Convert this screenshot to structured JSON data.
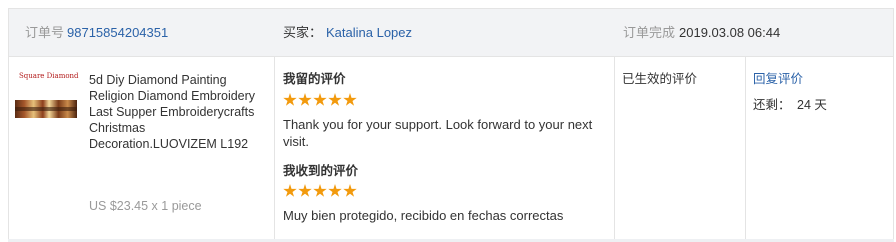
{
  "header": {
    "order_no_label": "订单号",
    "order_no_value": "98715854204351",
    "buyer_label": "买家：",
    "buyer_name": "Katalina Lopez",
    "completed_label": "订单完成",
    "completed_time": "2019.03.08 06:44"
  },
  "product": {
    "thumb_brand": "Square Diamond",
    "title": "5d Diy Diamond Painting Religion Diamond Embroidery Last Supper Embroiderycrafts Christmas Decoration.LUOVIZEM L192",
    "price": "US $23.45 x 1 piece"
  },
  "feedback": {
    "my_label": "我留的评价",
    "my_rating": 5,
    "my_text": "Thank you for your support. Look forward to your next visit.",
    "received_label": "我收到的评价",
    "received_rating": 5,
    "received_text": "Muy bien protegido, recibido en fechas correctas"
  },
  "status": {
    "label": "已生效的评价"
  },
  "action": {
    "reply_label": "回复评价",
    "remaining_label": "还剩：",
    "remaining_value": "24 天"
  },
  "colors": {
    "link": "#2b62a8",
    "star": "#f29a0d",
    "header_bg": "#f2f3f5"
  }
}
